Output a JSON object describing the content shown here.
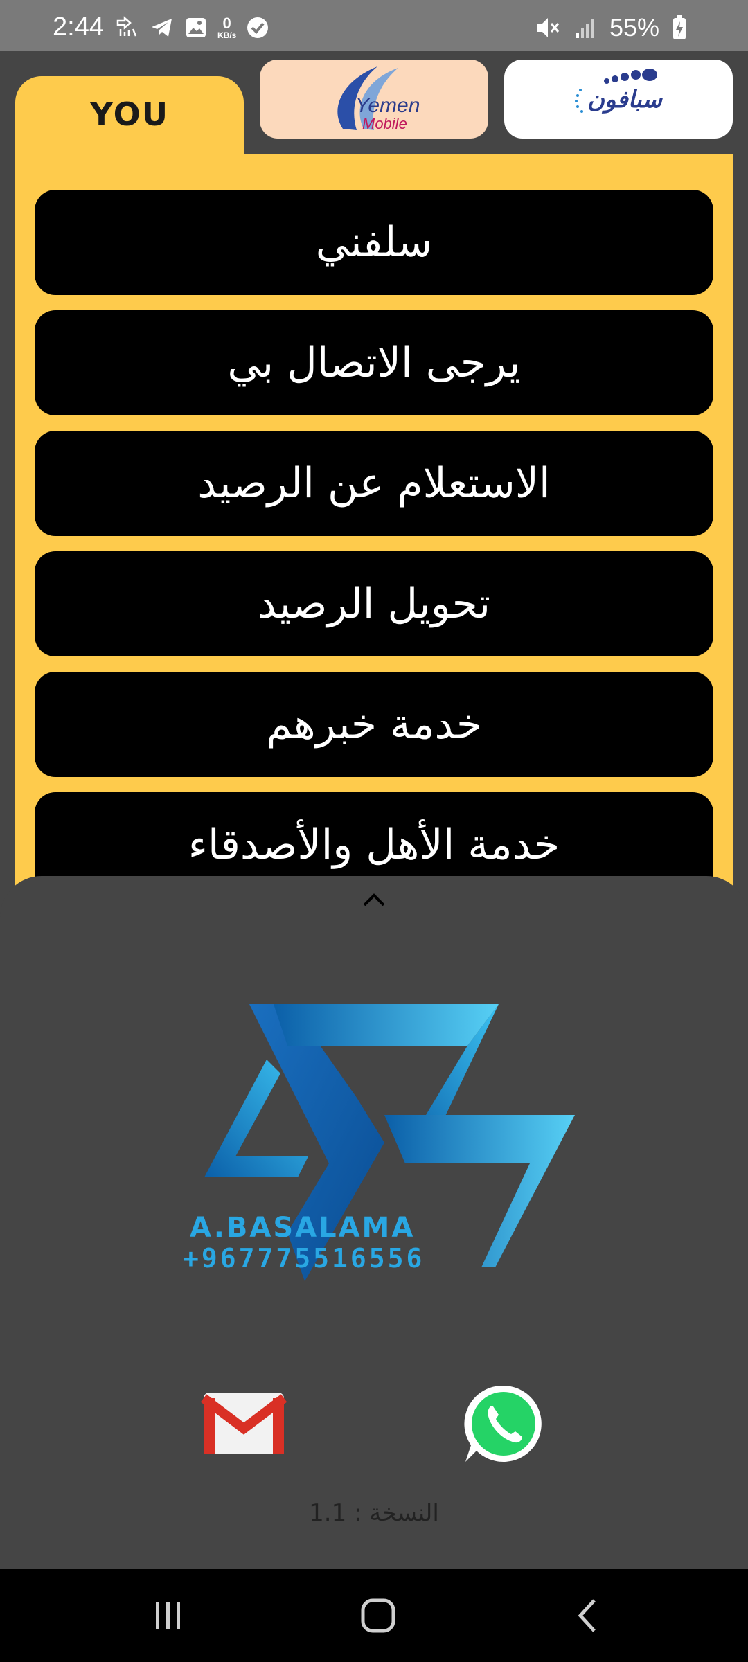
{
  "status_bar": {
    "time": "2:44",
    "net_speed_value": "0",
    "net_speed_unit": "KB/s",
    "battery_percent": "55%",
    "icons": [
      "call-forwarding-icon",
      "telegram-icon",
      "gallery-icon",
      "check-circle-icon",
      "mute-icon",
      "signal-icon",
      "battery-charging-icon"
    ]
  },
  "tabs": [
    {
      "id": "you",
      "label": "YOU",
      "active": true,
      "color": "#fecb4c"
    },
    {
      "id": "yemen-mobile",
      "label_top": "Yemen",
      "label_bottom": "Mobile",
      "active": false,
      "color": "#fcd9bc"
    },
    {
      "id": "sabafon",
      "label": "سبافون",
      "active": false,
      "color": "#ffffff"
    }
  ],
  "menu": {
    "items": [
      {
        "label": "سلفني"
      },
      {
        "label": "يرجى الاتصال بي"
      },
      {
        "label": "الاستعلام عن الرصيد"
      },
      {
        "label": "تحويل الرصيد"
      },
      {
        "label": "خدمة خبرهم"
      },
      {
        "label": "خدمة الأهل والأصدقاء"
      }
    ]
  },
  "sheet": {
    "logo_name": "A.BASALAMA",
    "logo_phone": "+967775516556",
    "contact_icons": [
      "gmail-icon",
      "whatsapp-icon"
    ],
    "version_text": "النسخة : 1.1"
  },
  "nav_bar": {
    "buttons": [
      "recent-apps-icon",
      "home-icon",
      "back-icon"
    ]
  },
  "colors": {
    "panel": "#fecb4c",
    "background": "#454545",
    "button": "#000000",
    "logo_blue": "#29a7e3"
  }
}
